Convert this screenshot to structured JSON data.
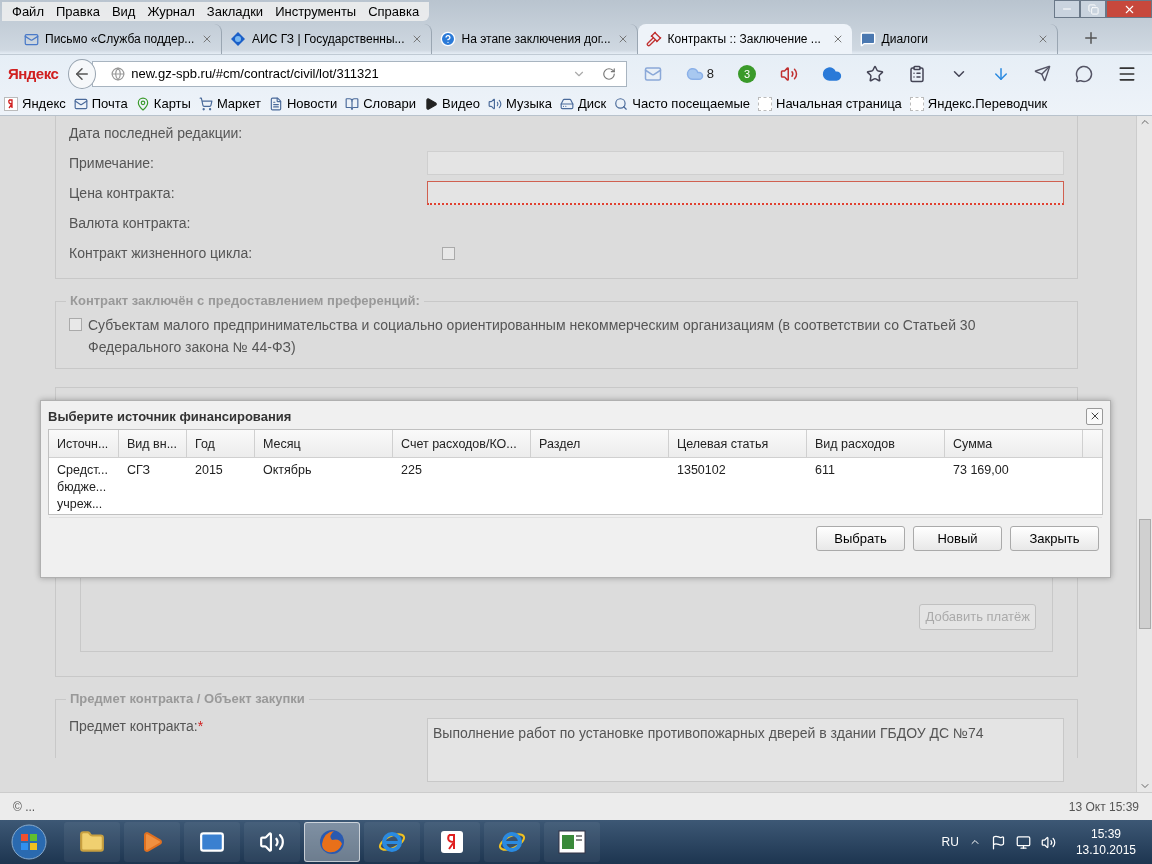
{
  "menu": [
    "Файл",
    "Правка",
    "Вид",
    "Журнал",
    "Закладки",
    "Инструменты",
    "Справка"
  ],
  "tabs": [
    {
      "title": "Письмо «Служба поддер...",
      "kind": "mail",
      "selected": false
    },
    {
      "title": "АИС ГЗ | Государственны...",
      "kind": "logo",
      "selected": false
    },
    {
      "title": "На этапе заключения дог...",
      "kind": "help",
      "selected": false
    },
    {
      "title": "Контракты :: Заключение ...",
      "kind": "gavel",
      "selected": true
    },
    {
      "title": "Диалоги",
      "kind": "chat",
      "selected": false
    }
  ],
  "address_bar": {
    "brand": "Яндекс",
    "url": "new.gz-spb.ru/#cm/contract/civil/lot/311321"
  },
  "toolbar": {
    "cloud_count": "8",
    "badge_count": "3"
  },
  "bookmarks": [
    {
      "label": "Яндекс",
      "kind": "yandex"
    },
    {
      "label": "Почта",
      "kind": "mail"
    },
    {
      "label": "Карты",
      "kind": "maps"
    },
    {
      "label": "Маркет",
      "kind": "market"
    },
    {
      "label": "Новости",
      "kind": "page"
    },
    {
      "label": "Словари",
      "kind": "book"
    },
    {
      "label": "Видео",
      "kind": "video"
    },
    {
      "label": "Музыка",
      "kind": "music"
    },
    {
      "label": "Диск",
      "kind": "disk"
    },
    {
      "label": "Часто посещаемые",
      "kind": "search"
    },
    {
      "label": "Начальная страница",
      "kind": "blank"
    },
    {
      "label": "Яндекс.Переводчик",
      "kind": "blank"
    }
  ],
  "form": {
    "fields": [
      {
        "label": "Дата последней редакции:",
        "kind": "text"
      },
      {
        "label": "Примечание:",
        "kind": "input",
        "invalid": false
      },
      {
        "label": "Цена контракта:",
        "kind": "input",
        "invalid": true
      },
      {
        "label": "Валюта контракта:",
        "kind": "text"
      },
      {
        "label": "Контракт жизненного цикла:",
        "kind": "checkbox",
        "checked": false
      }
    ]
  },
  "preferences": {
    "legend": "Контракт заключён с предоставлением преференций:",
    "option": {
      "label": "Субъектам малого предпринимательства и социально ориентированным некоммерческим организациям (в соответствии со Статьей 30 Федерального закона № 44-ФЗ)",
      "checked": false
    }
  },
  "payment_stages": {
    "add_button": {
      "label": "Добавить платёж",
      "disabled": true
    }
  },
  "subject": {
    "legend": "Предмет контракта / Объект закупки",
    "label": "Предмет контракта:",
    "required_mark": "*",
    "value": "Выполнение работ по установке противопожарных дверей в здании ГБДОУ ДС №74"
  },
  "dialog": {
    "title": "Выберите источник финансирования",
    "columns": [
      "Источн...",
      "Вид вн...",
      "Год",
      "Месяц",
      "Счет расходов/КО...",
      "Раздел",
      "Целевая статья",
      "Вид расходов",
      "Сумма"
    ],
    "rows": [
      [
        "Средст...\nбюдже...\nучреж...",
        "СГЗ",
        "2015",
        "Октябрь",
        "225",
        "",
        "1350102",
        "611",
        "73 169,00"
      ]
    ],
    "buttons": [
      "Выбрать",
      "Новый",
      "Закрыть"
    ]
  },
  "status_bar": {
    "left": "© ...",
    "right": "13 Окт 15:39"
  },
  "taskbar": {
    "apps": [
      {
        "kind": "folder",
        "selected": false
      },
      {
        "kind": "player",
        "selected": false
      },
      {
        "kind": "mail",
        "selected": false
      },
      {
        "kind": "sound",
        "selected": false
      },
      {
        "kind": "firefox",
        "selected": true
      },
      {
        "kind": "ie",
        "selected": false
      },
      {
        "kind": "yandex",
        "selected": false
      },
      {
        "kind": "ie",
        "selected": false
      },
      {
        "kind": "window",
        "selected": false
      }
    ],
    "language": "RU",
    "time": "15:39",
    "date": "13.10.2015"
  }
}
